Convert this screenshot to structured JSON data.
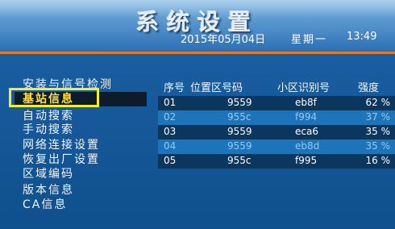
{
  "header": {
    "title": "系统设置",
    "date": "2015年05月04日",
    "weekday": "星期一",
    "time": "13:49"
  },
  "menu": {
    "items": [
      {
        "label": "安装与信号检测"
      },
      {
        "label": "基站信息"
      },
      {
        "label": "自动搜索"
      },
      {
        "label": "手动搜索"
      },
      {
        "label": "网络连接设置"
      },
      {
        "label": "恢复出厂设置"
      },
      {
        "label": "区域编码"
      },
      {
        "label": "版本信息"
      },
      {
        "label": "CA信息"
      }
    ],
    "selected_index": 1
  },
  "table": {
    "headers": {
      "no": "序号",
      "pos": "位置区号码",
      "cell": "小区识别号",
      "sig": "强度"
    },
    "rows": [
      {
        "no": "01",
        "pos": "9559",
        "cell": "eb8f",
        "sig": "62 %"
      },
      {
        "no": "02",
        "pos": "955c",
        "cell": "f994",
        "sig": "37 %"
      },
      {
        "no": "03",
        "pos": "9559",
        "cell": "eca6",
        "sig": "35 %"
      },
      {
        "no": "04",
        "pos": "9559",
        "cell": "eb8d",
        "sig": "35 %"
      },
      {
        "no": "05",
        "pos": "955c",
        "cell": "f995",
        "sig": "16 %"
      }
    ]
  },
  "colors": {
    "background": "#175a9b",
    "divider": "#e07a2a",
    "selection_box": "#f3ee2b",
    "selected_text": "#ffe14a",
    "row_dark": "#0b365e",
    "row_light": "#1e74b8",
    "row_text_blue": "#8fcaf8"
  }
}
